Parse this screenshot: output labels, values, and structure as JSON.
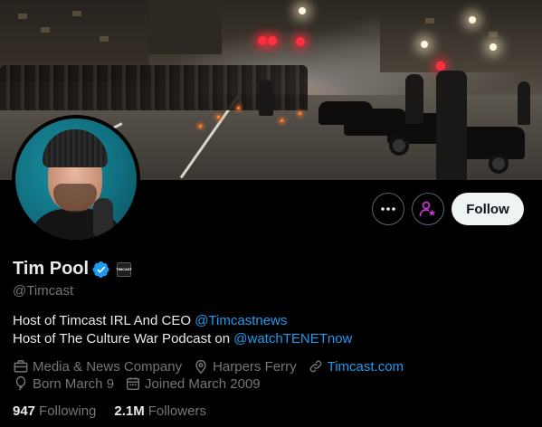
{
  "profile": {
    "name": "Tim Pool",
    "handle": "@Timcast",
    "affiliate_badge_text": "TIMCAST",
    "bio_line1_text": "Host of Timcast IRL And CEO ",
    "bio_line1_mention": "@Timcastnews",
    "bio_line2_text": "Host of The Culture War Podcast on ",
    "bio_line2_mention": "@watchTENETnow",
    "category": "Media & News Company",
    "location": "Harpers Ferry",
    "website": "Timcast.com",
    "birthday": "Born March 9",
    "joined": "Joined March 2009"
  },
  "stats": {
    "following_count": "947",
    "following_label": "Following",
    "followers_count": "2.1M",
    "followers_label": "Followers"
  },
  "actions": {
    "follow_label": "Follow",
    "more_icon": "more-horizontal-icon",
    "subscribe_icon": "person-star-icon"
  },
  "colors": {
    "background": "#000000",
    "text_primary": "#e7e9ea",
    "text_secondary": "#71767b",
    "link": "#1d9bf0",
    "verified": "#1d9bf0",
    "subscribe_accent": "#c936cc",
    "follow_button_bg": "#eff3f4"
  }
}
